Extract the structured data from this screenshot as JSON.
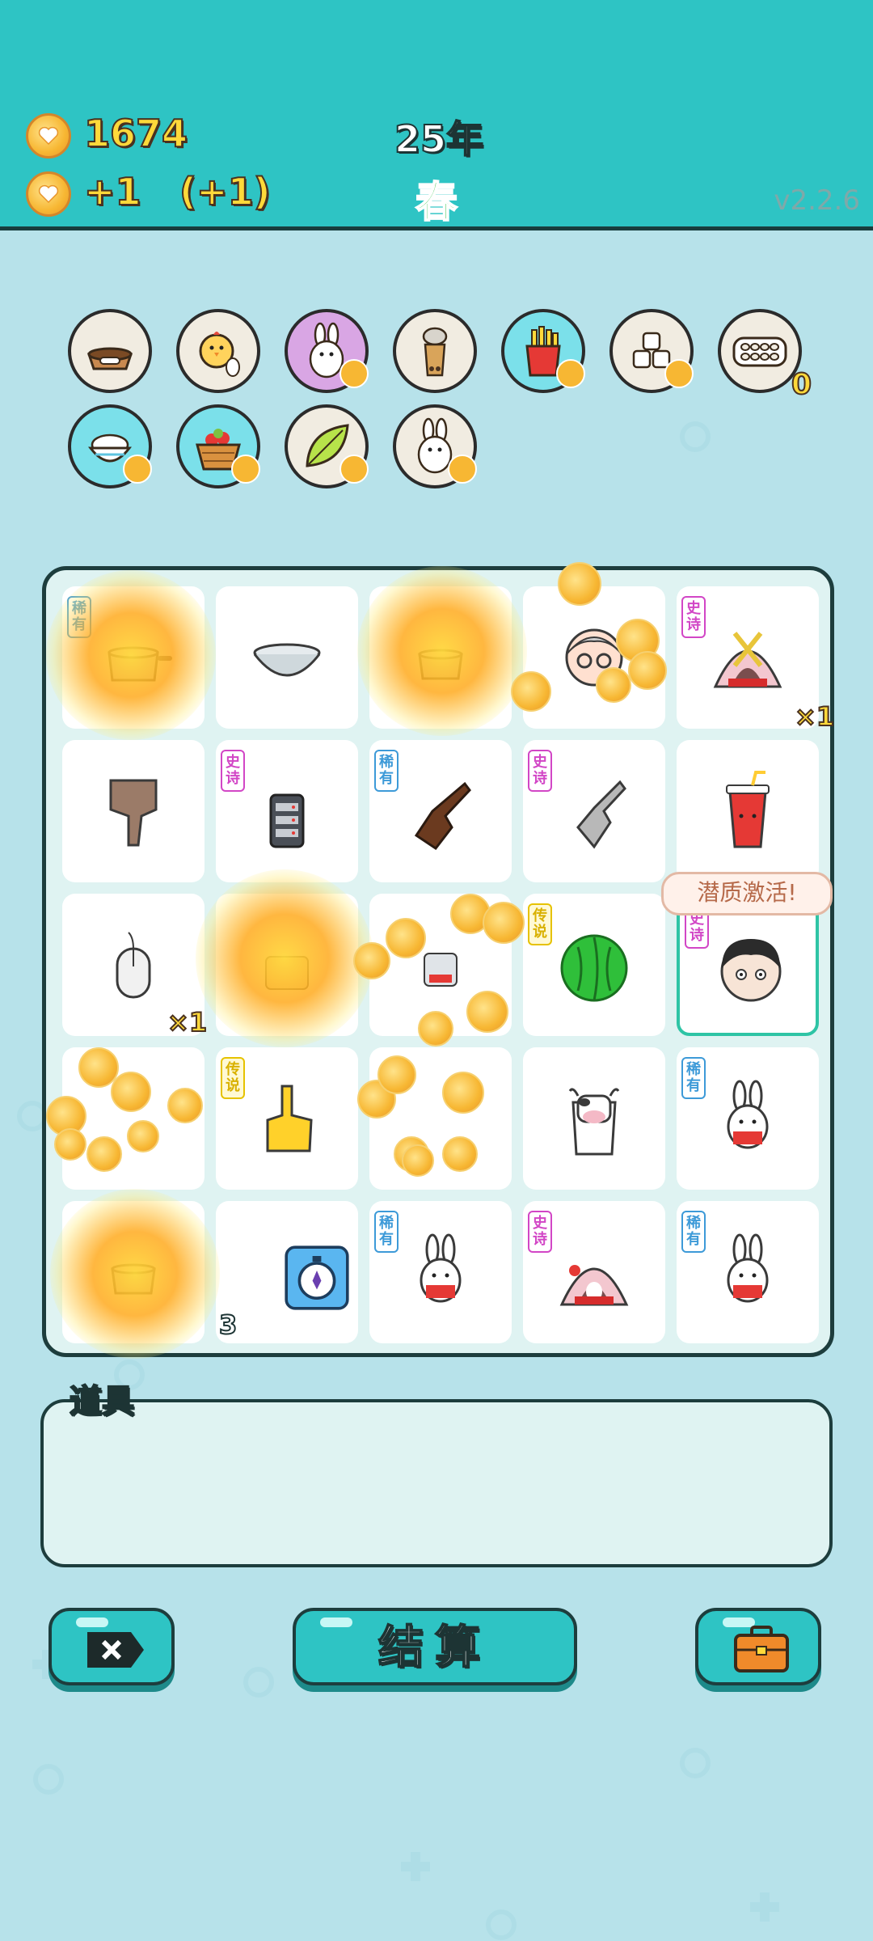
{
  "header": {
    "coins": "1674",
    "income": "+1",
    "income_bonus": "(+1)",
    "year": "25年",
    "season": "春",
    "version": "v2.2.6"
  },
  "inventory": [
    {
      "icon": "dog-bowl-icon"
    },
    {
      "icon": "chick-egg-icon"
    },
    {
      "icon": "rabbit-icon"
    },
    {
      "icon": "bubble-tea-icon"
    },
    {
      "icon": "fries-icon"
    },
    {
      "icon": "sugar-cubes-icon"
    },
    {
      "icon": "egg-tray-icon",
      "count": "0"
    },
    {
      "icon": "rice-bowl-icon"
    },
    {
      "icon": "fruit-basket-icon"
    },
    {
      "icon": "leaf-icon"
    },
    {
      "icon": "rabbit-icon"
    }
  ],
  "rarity_labels": {
    "rare": "稀有",
    "epic": "史诗",
    "legend": "传说"
  },
  "board": {
    "multipliers": [
      "×1",
      "×1"
    ],
    "counter": "3",
    "tooltip": "潜质激活!"
  },
  "items_panel": {
    "label": "道具"
  },
  "buttons": {
    "settle": "结算",
    "close_icon": "close-tag-icon",
    "bag_icon": "briefcase-icon"
  },
  "colors": {
    "header": "#2ec4c4",
    "background": "#b7e2ea",
    "coin": "#f7b733"
  }
}
